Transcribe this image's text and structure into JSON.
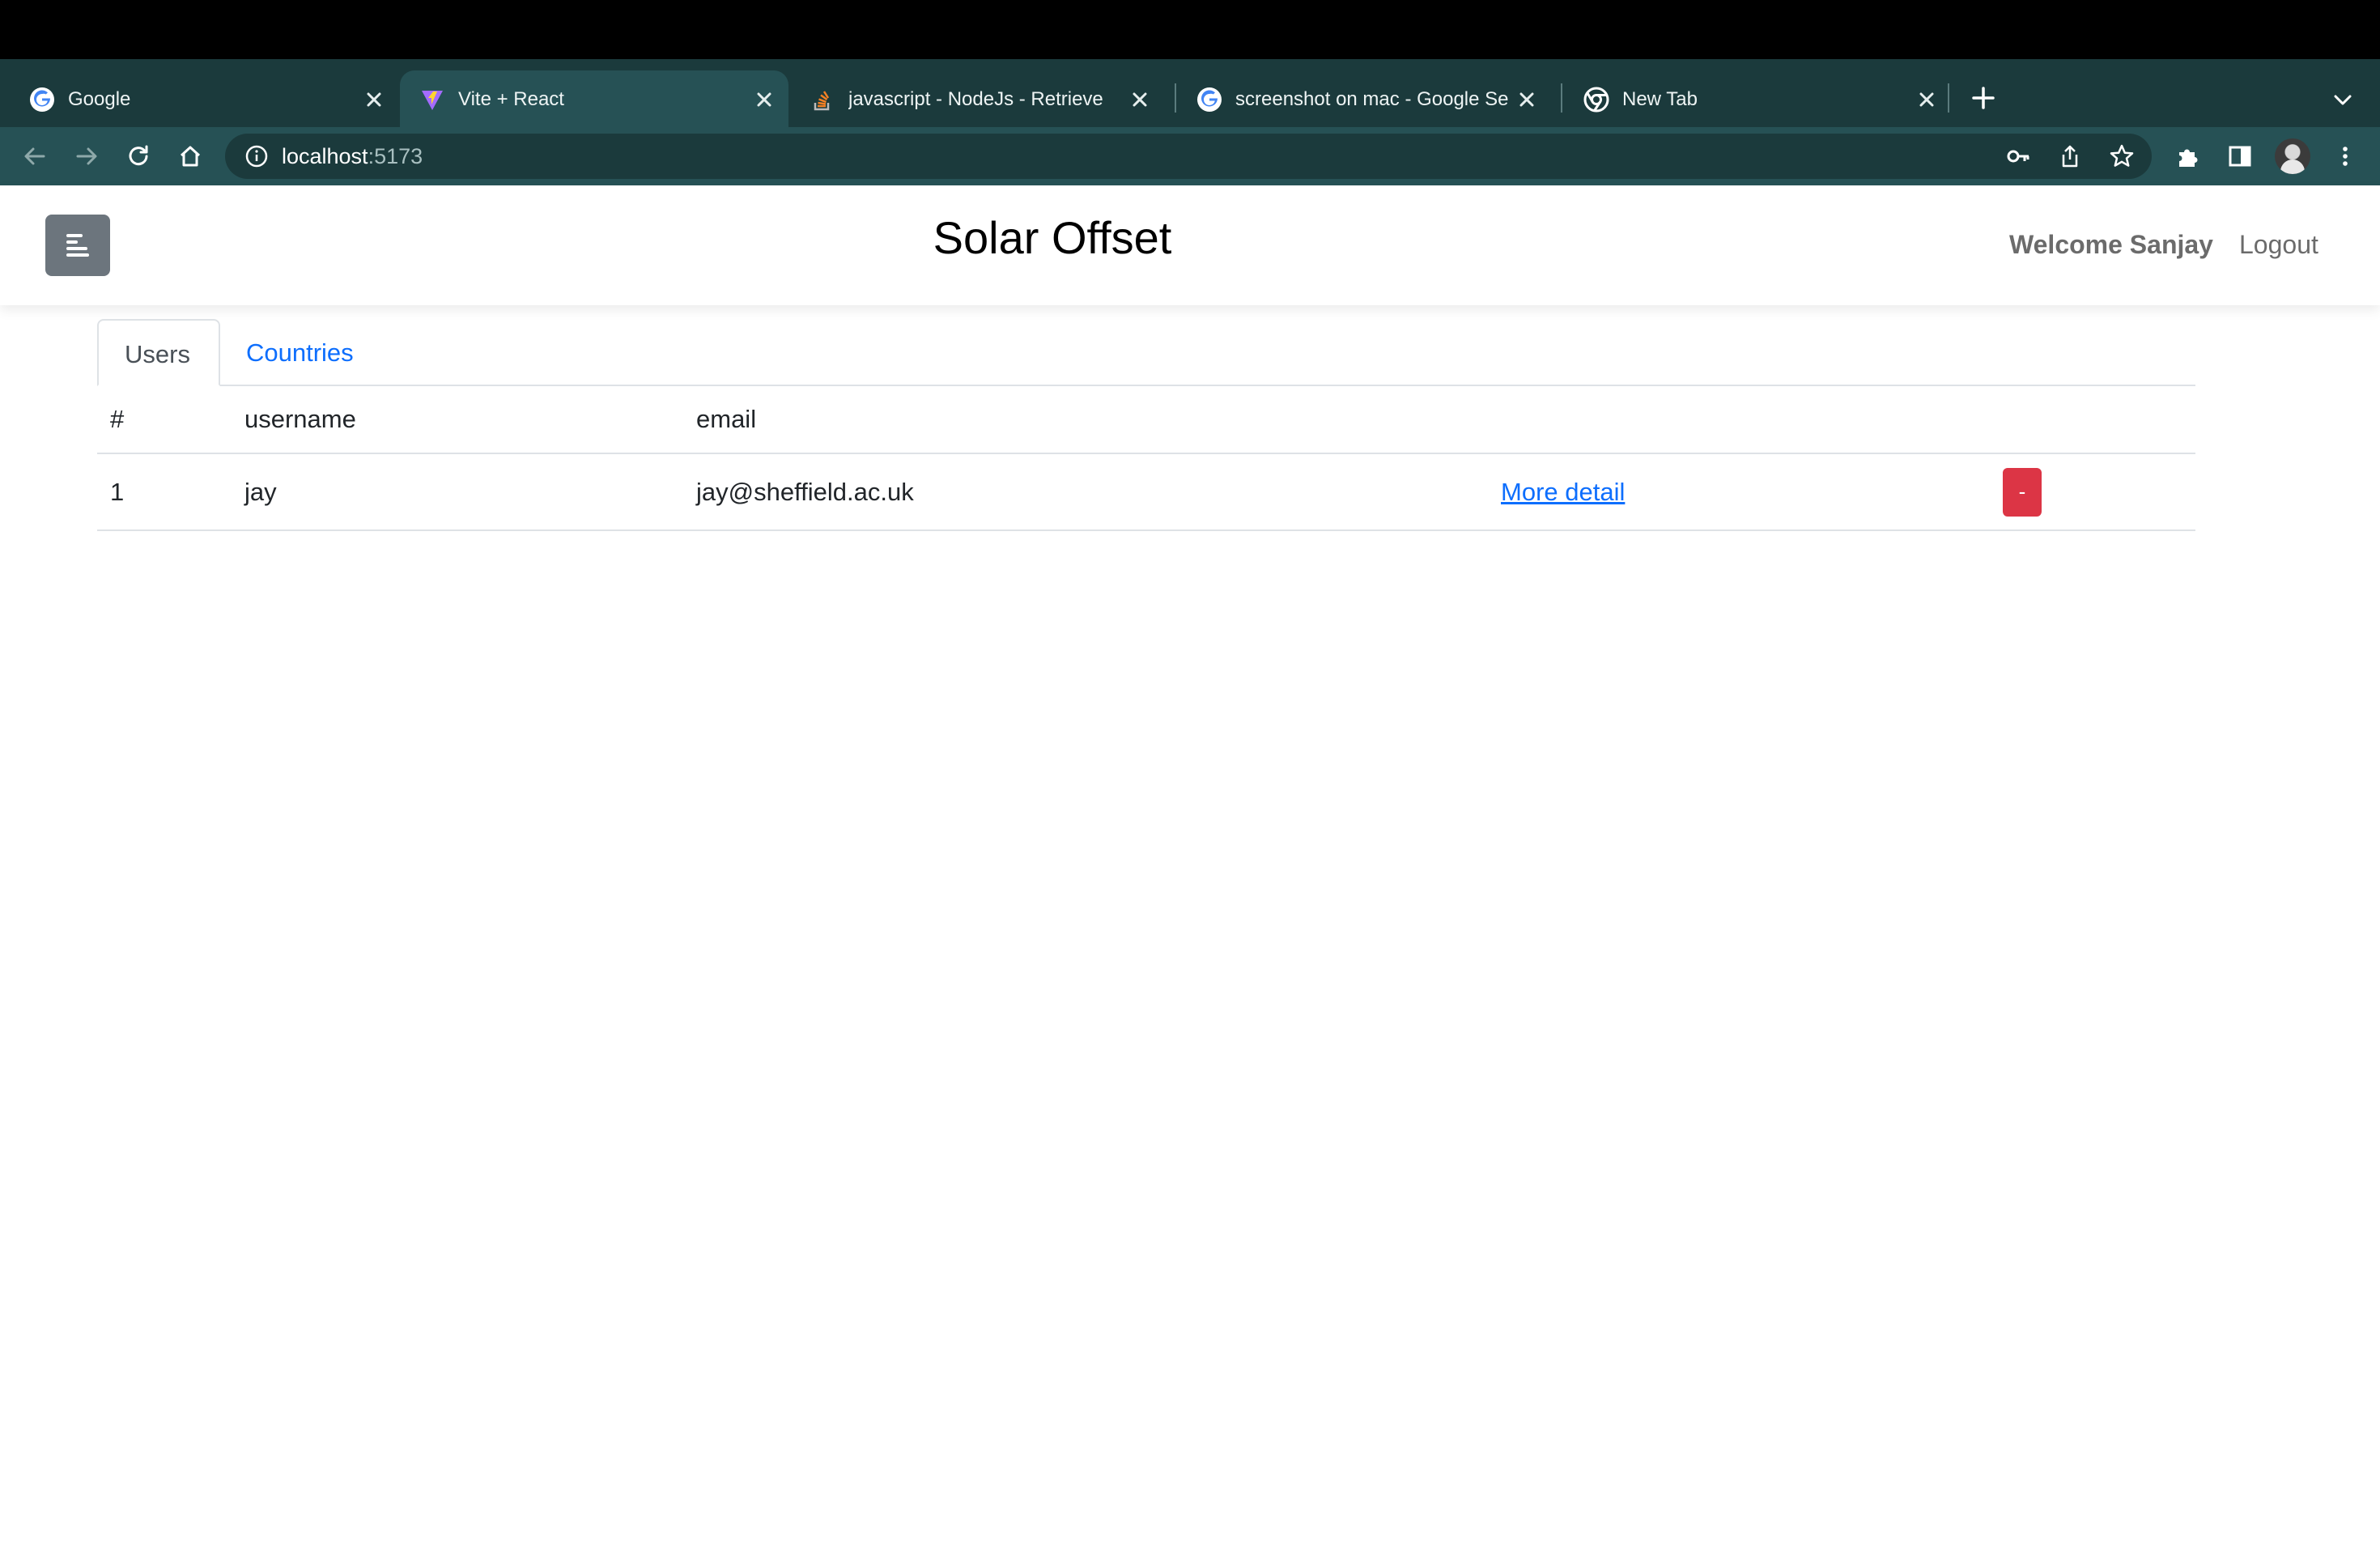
{
  "browser": {
    "tabs": [
      {
        "title": "Google",
        "icon": "google-icon",
        "active": false
      },
      {
        "title": "Vite + React",
        "icon": "vite-icon",
        "active": true
      },
      {
        "title": "javascript - NodeJs - Retrieve",
        "icon": "stackoverflow-icon",
        "active": false
      },
      {
        "title": "screenshot on mac - Google Se",
        "icon": "google-icon",
        "active": false
      },
      {
        "title": "New Tab",
        "icon": "chrome-icon",
        "active": false
      }
    ],
    "url_host": "localhost",
    "url_port": ":5173"
  },
  "app": {
    "title": "Solar Offset",
    "welcome": "Welcome Sanjay",
    "logout": "Logout"
  },
  "nav": {
    "tabs": [
      {
        "label": "Users",
        "active": true
      },
      {
        "label": "Countries",
        "active": false
      }
    ]
  },
  "table": {
    "headers": [
      "#",
      "username",
      "email"
    ],
    "rows": [
      {
        "num": "1",
        "username": "jay",
        "email": "jay@sheffield.ac.uk",
        "detail": "More detail",
        "action": "-"
      }
    ]
  },
  "colors": {
    "tab_strip": "#1b3a3c",
    "toolbar": "#265155",
    "menu_button": "#6c757d",
    "link": "#0d6efd",
    "danger": "#dc3545"
  }
}
